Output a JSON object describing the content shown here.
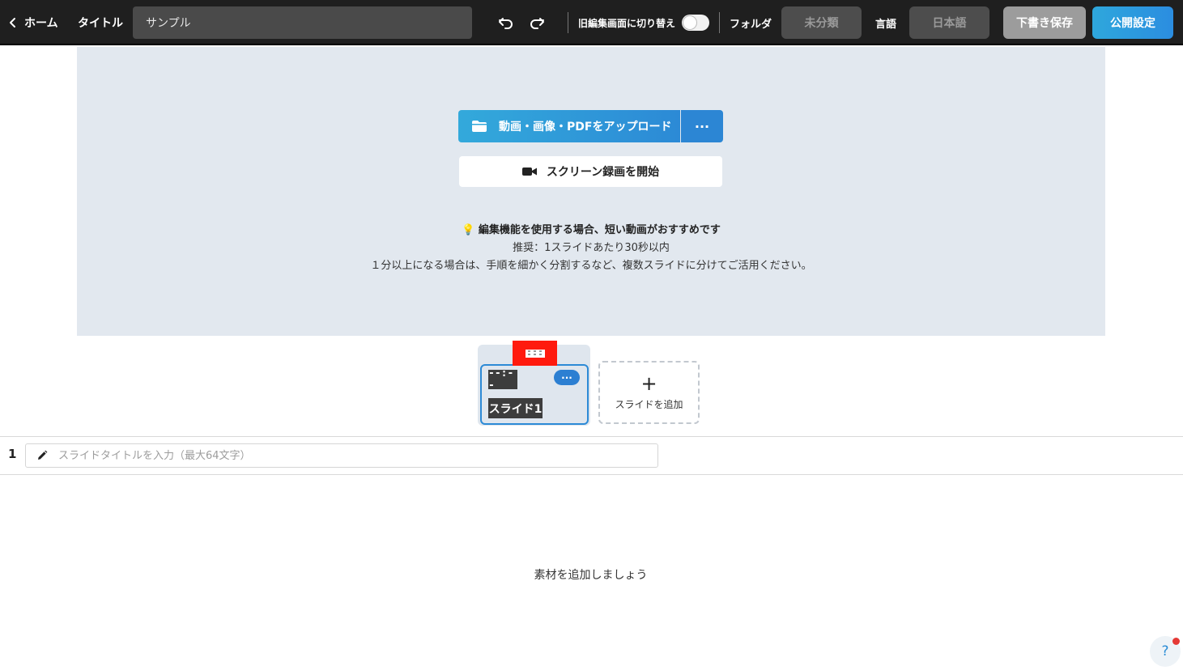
{
  "header": {
    "back_label": "ホーム",
    "title_label": "タイトル",
    "title_value": "サンプル",
    "old_editor_label": "旧編集画面に切り替え",
    "old_editor_enabled": false,
    "folder_label": "フォルダ",
    "folder_value": "未分類",
    "language_label": "言語",
    "language_value": "日本語",
    "draft_save_label": "下書き保存",
    "publish_label": "公開設定"
  },
  "upload": {
    "upload_button_label": "動画・画像・PDFをアップロード",
    "more_label": "···",
    "record_button_label": "スクリーン録画を開始",
    "hint_title": "編集機能を使用する場合、短い動画がおすすめです",
    "hint_line_2": "推奨：1スライドあたり30秒以内",
    "hint_line_3": "１分以上になる場合は、手順を細かく分割するなど、複数スライドに分けてご活用ください。"
  },
  "slides": {
    "items": [
      {
        "duration": "--:--",
        "name": "スライド1",
        "more_label": "···",
        "selected": true
      }
    ],
    "add_slide_label": "スライドを追加",
    "add_slide_icon": "+"
  },
  "slide_title": {
    "number": "1",
    "placeholder": "スライドタイトルを入力（最大64文字）",
    "value": ""
  },
  "empty_message": "素材を追加しましょう",
  "help": {
    "label": "?"
  },
  "colors": {
    "topbar": "#1f1f1f",
    "accent": "#2c8ad6",
    "upload_area": "#e2e8ef",
    "drag_handle": "#ff1a0e",
    "notification_dot": "#e53935"
  }
}
